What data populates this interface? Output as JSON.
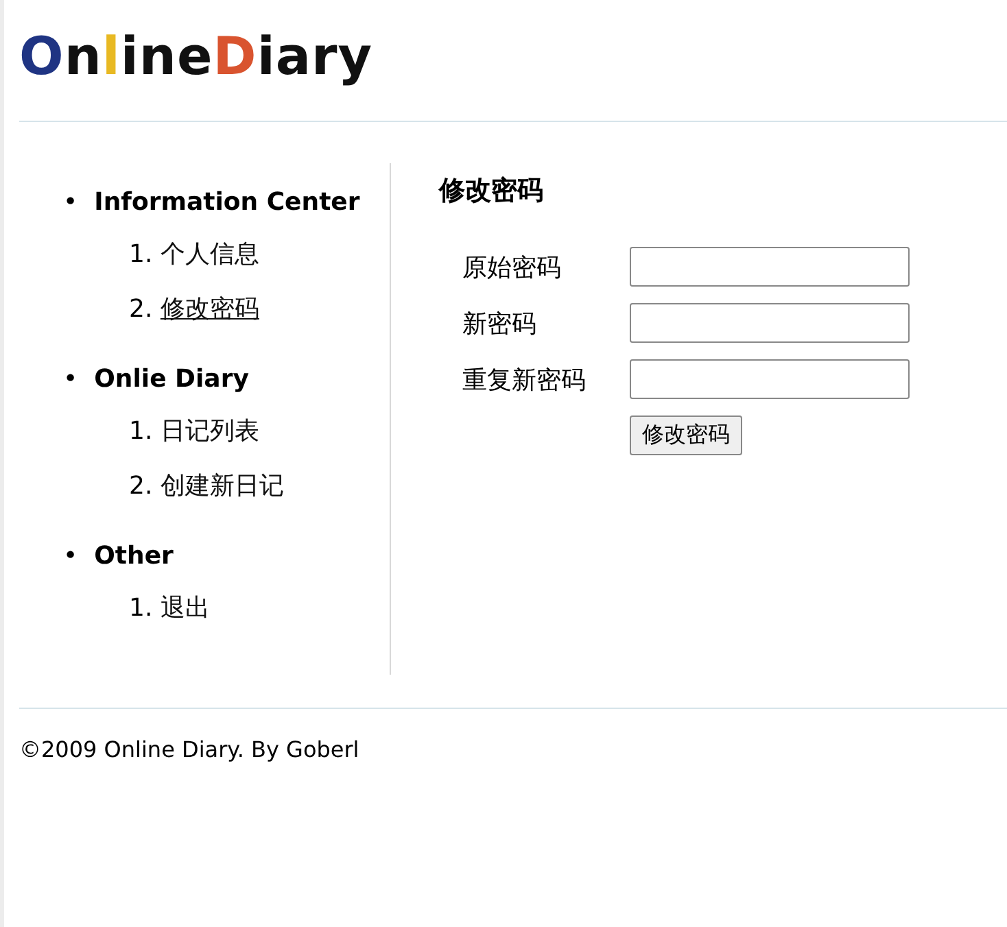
{
  "logo": [
    {
      "text": "O",
      "color": "#1f3483"
    },
    {
      "text": "n",
      "color": "#111111"
    },
    {
      "text": "l",
      "color": "#e8b923"
    },
    {
      "text": "ine",
      "color": "#111111"
    },
    {
      "text": "D",
      "color": "#d9542f"
    },
    {
      "text": "iary",
      "color": "#111111"
    }
  ],
  "sidebar": {
    "sections": [
      {
        "marker": "•",
        "title": "Information Center",
        "items": [
          {
            "number": "1.",
            "label": "个人信息",
            "selected": false
          },
          {
            "number": "2.",
            "label": "修改密码",
            "selected": true
          }
        ]
      },
      {
        "marker": "•",
        "title": "Onlie Diary",
        "items": [
          {
            "number": "1.",
            "label": "日记列表",
            "selected": false
          },
          {
            "number": "2.",
            "label": "创建新日记",
            "selected": false
          }
        ]
      },
      {
        "marker": "•",
        "title": "Other",
        "items": [
          {
            "number": "1.",
            "label": "退出",
            "selected": false
          }
        ]
      }
    ]
  },
  "form": {
    "title": "修改密码",
    "fields": [
      {
        "label": "原始密码"
      },
      {
        "label": "新密码"
      },
      {
        "label": "重复新密码"
      }
    ],
    "submit": "修改密码"
  },
  "footer": "©2009 Online Diary. By Goberl"
}
